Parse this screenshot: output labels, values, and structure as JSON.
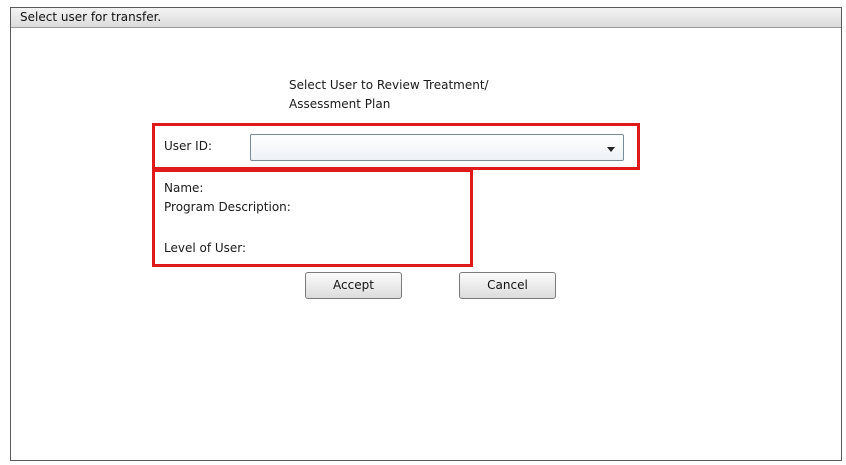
{
  "window": {
    "title": "Select user for transfer."
  },
  "dialog": {
    "heading_line1": "Select User to Review Treatment/",
    "heading_line2": "Assessment Plan",
    "user_id_label": "User ID:",
    "user_id_value": "",
    "name_label": "Name:",
    "program_description_label": "Program Description:",
    "level_of_user_label": "Level of User:",
    "accept_label": "Accept",
    "cancel_label": "Cancel"
  },
  "colors": {
    "highlight_border": "#e01a1a",
    "titlebar": "#dcdcdc"
  },
  "icons": {
    "dropdown": "chevron-down-icon"
  }
}
